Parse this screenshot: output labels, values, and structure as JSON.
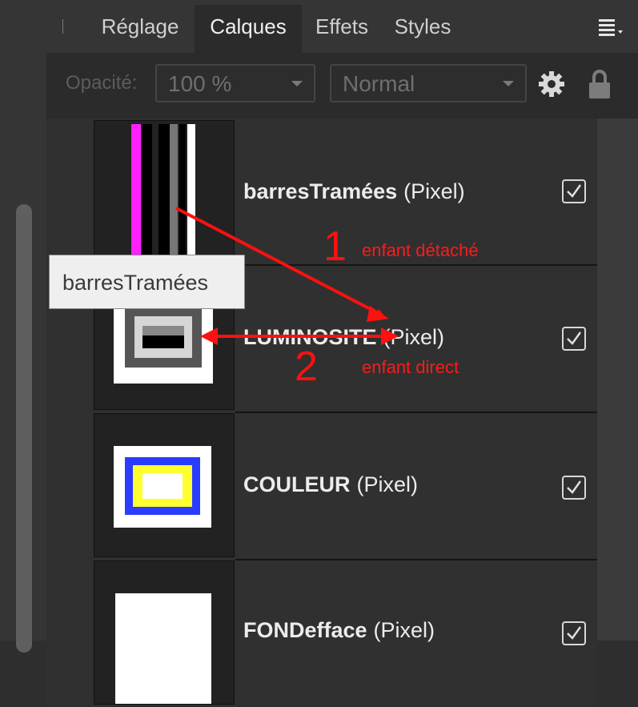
{
  "tabs": [
    {
      "label": "Réglage",
      "active": false
    },
    {
      "label": "Calques",
      "active": true
    },
    {
      "label": "Effets",
      "active": false
    },
    {
      "label": "Styles",
      "active": false
    }
  ],
  "toolbar": {
    "opacity_label": "Opacité:",
    "opacity_value": "100 %",
    "blend_mode": "Normal",
    "settings_icon": "gear-icon",
    "lock_icon": "lock-icon"
  },
  "layers": [
    {
      "name": "barresTramées",
      "type": "(Pixel)",
      "visible": true
    },
    {
      "name": "LUMINOSITE",
      "type": "(Pixel)",
      "visible": true
    },
    {
      "name": "COULEUR",
      "type": "(Pixel)",
      "visible": true
    },
    {
      "name": "FONDefface",
      "type": "(Pixel)",
      "visible": true
    }
  ],
  "tooltip": "barresTramées",
  "annotations": {
    "num1": "1",
    "label1": "enfant détaché",
    "num2": "2",
    "label2": "enfant direct",
    "color": "#ff1010"
  },
  "colors": {
    "panel_bg": "#2e2e2e",
    "tab_active_bg": "#2b2b2b",
    "text": "#ececec"
  }
}
